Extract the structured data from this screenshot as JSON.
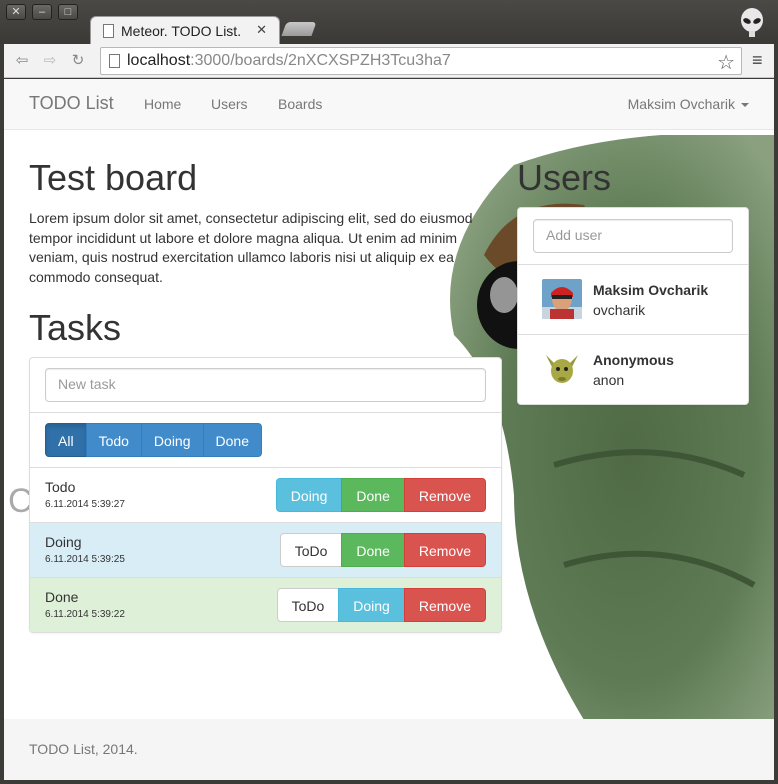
{
  "window": {
    "tab_title": "Meteor. TODO List.",
    "url_host": "localhost",
    "url_rest": ":3000/boards/2nXCXSPZH3Tcu3ha7"
  },
  "navbar": {
    "brand": "TODO List",
    "links": [
      "Home",
      "Users",
      "Boards"
    ],
    "user": "Maksim Ovcharik"
  },
  "board": {
    "title": "Test board",
    "description": "Lorem ipsum dolor sit amet, consectetur adipiscing elit, sed do eiusmod tempor incididunt ut labore et dolore magna aliqua. Ut enim ad minim veniam, quis nostrud exercitation ullamco laboris nisi ut aliquip ex ea commodo consequat."
  },
  "tasks": {
    "heading": "Tasks",
    "new_task_placeholder": "New task",
    "filters": [
      "All",
      "Todo",
      "Doing",
      "Done"
    ],
    "items": [
      {
        "name": "Todo",
        "date": "6.11.2014 5:39:27",
        "actions": [
          "Doing",
          "Done",
          "Remove"
        ]
      },
      {
        "name": "Doing",
        "date": "6.11.2014 5:39:25",
        "actions": [
          "ToDo",
          "Done",
          "Remove"
        ]
      },
      {
        "name": "Done",
        "date": "6.11.2014 5:39:22",
        "actions": [
          "ToDo",
          "Doing",
          "Remove"
        ]
      }
    ]
  },
  "users": {
    "heading": "Users",
    "add_placeholder": "Add user",
    "items": [
      {
        "name": "Maksim Ovcharik",
        "login": "ovcharik"
      },
      {
        "name": "Anonymous",
        "login": "anon"
      }
    ]
  },
  "stray_glyph": "C",
  "footer": "TODO List, 2014.",
  "colors": {
    "primary": "#428bca",
    "info": "#5bc0de",
    "success": "#5cb85c",
    "danger": "#d9534f"
  }
}
